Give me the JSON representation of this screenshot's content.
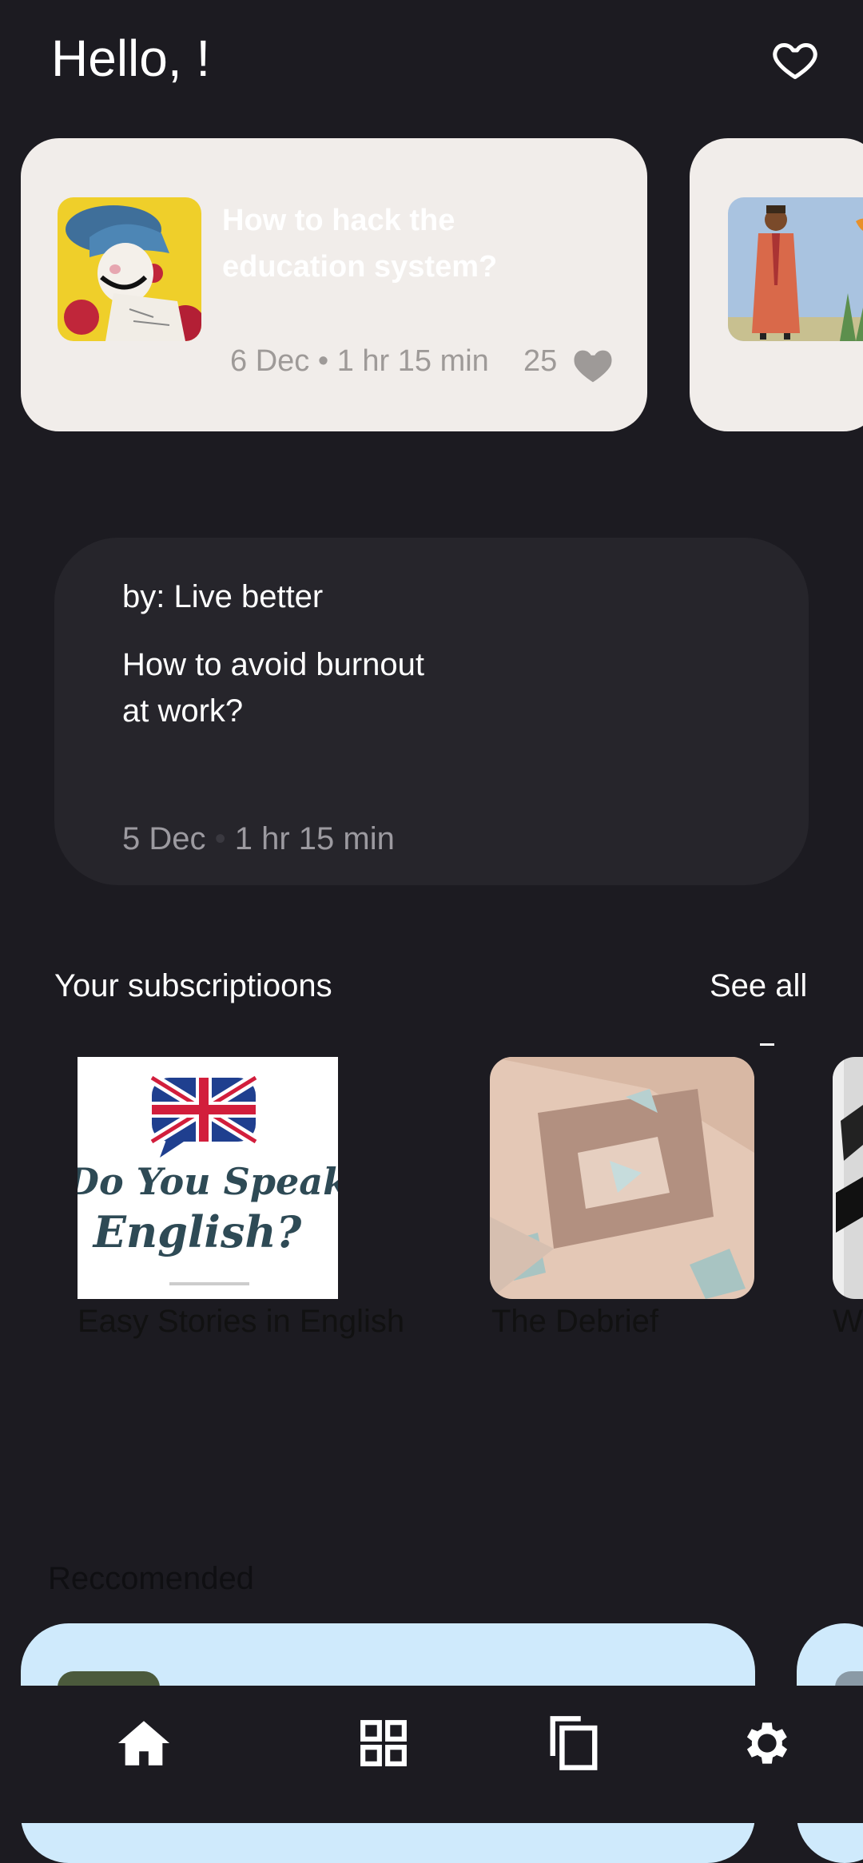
{
  "header": {
    "greeting": "Hello,   !",
    "favorites_icon": "heart-outline-icon"
  },
  "featured": [
    {
      "title_line1": "How to hack the",
      "title_line2": " education system?",
      "date": "6 Dec",
      "duration": "1 hr 15 min",
      "likes": "25",
      "like_icon": "heart-filled-icon"
    },
    {
      "title_line1": "",
      "title_line2": ""
    }
  ],
  "article": {
    "author": "by: Live better",
    "title_line1": "How to avoid burnout",
    "title_line2": "at work?",
    "date": "5 Dec",
    "duration": "1 hr 15 min"
  },
  "subscriptions": {
    "title": "Your subscriptioons",
    "see_all": "See all",
    "items": [
      {
        "name": "Easy Stories in English",
        "cover_text_1": "Do You Speak",
        "cover_text_2": "English?"
      },
      {
        "name": "The Debrief"
      },
      {
        "name": "W"
      }
    ]
  },
  "recommended": {
    "title": "Reccomended"
  },
  "bottom_nav": [
    {
      "icon": "home-icon",
      "active": true
    },
    {
      "icon": "grid-icon",
      "active": false
    },
    {
      "icon": "copy-icon",
      "active": false
    },
    {
      "icon": "settings-gear-icon",
      "active": false
    }
  ],
  "colors": {
    "background": "#1c1b21",
    "featured_card": "#f1edea",
    "article_card": "#26252b",
    "recommended_card": "#cfeafc"
  }
}
